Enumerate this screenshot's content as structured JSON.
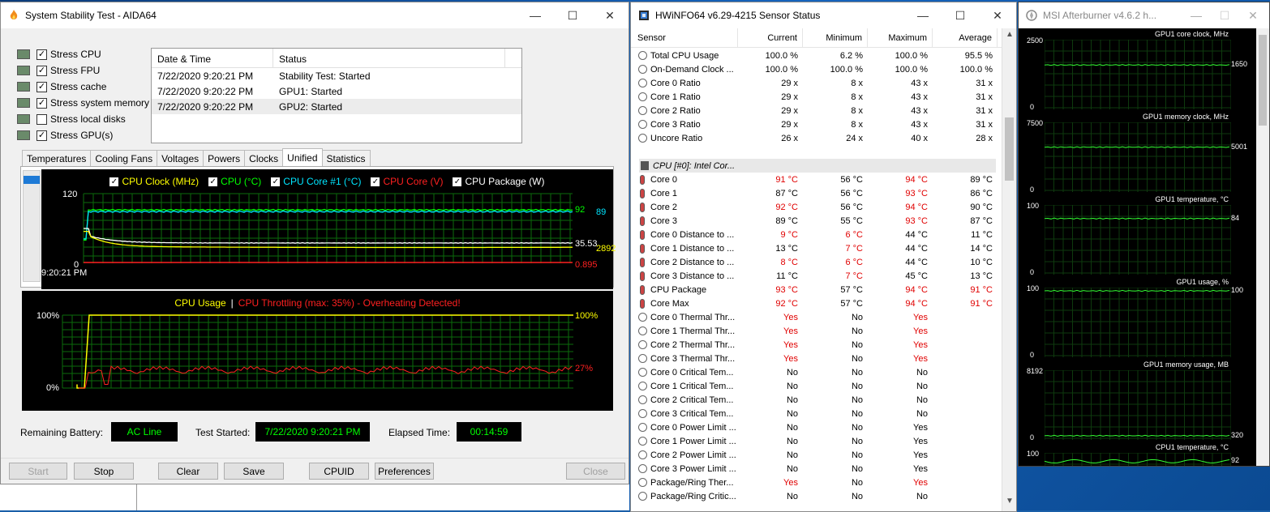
{
  "aida": {
    "title": "System Stability Test - AIDA64",
    "stress": [
      {
        "label": "Stress CPU",
        "checked": true
      },
      {
        "label": "Stress FPU",
        "checked": true
      },
      {
        "label": "Stress cache",
        "checked": true
      },
      {
        "label": "Stress system memory",
        "checked": true
      },
      {
        "label": "Stress local disks",
        "checked": false
      },
      {
        "label": "Stress GPU(s)",
        "checked": true
      }
    ],
    "status_headers": [
      "Date & Time",
      "Status"
    ],
    "status_rows": [
      [
        "7/22/2020 9:20:21 PM",
        "Stability Test: Started"
      ],
      [
        "7/22/2020 9:20:22 PM",
        "GPU1: Started"
      ],
      [
        "7/22/2020 9:20:22 PM",
        "GPU2: Started"
      ]
    ],
    "tabs": [
      "Temperatures",
      "Cooling Fans",
      "Voltages",
      "Powers",
      "Clocks",
      "Unified",
      "Statistics"
    ],
    "active_tab": "Unified",
    "graph1": {
      "legend": [
        {
          "label": "CPU Clock (MHz)",
          "color": "#ffff00"
        },
        {
          "label": "CPU (°C)",
          "color": "#00ff00"
        },
        {
          "label": "CPU Core #1 (°C)",
          "color": "#00e5ff"
        },
        {
          "label": "CPU Core (V)",
          "color": "#ff2020"
        },
        {
          "label": "CPU Package (W)",
          "color": "#ffffff"
        }
      ],
      "y_max": "120",
      "y_min": "0",
      "time": "9:20:21 PM",
      "val_cpu": "92",
      "val_core1": "89",
      "val_pkg": "35.53",
      "val_clock": "2892",
      "val_volt": "0.895"
    },
    "graph2": {
      "title_usage": "CPU Usage",
      "sep": "|",
      "title_throttle": "CPU Throttling (max: 35%) - Overheating Detected!",
      "y_max": "100%",
      "y_min": "0%",
      "val_usage": "100%",
      "val_throttle": "27%"
    },
    "info": {
      "battery_label": "Remaining Battery:",
      "battery_value": "AC Line",
      "started_label": "Test Started:",
      "started_value": "7/22/2020 9:20:21 PM",
      "elapsed_label": "Elapsed Time:",
      "elapsed_value": "00:14:59"
    },
    "buttons": {
      "start": "Start",
      "stop": "Stop",
      "clear": "Clear",
      "save": "Save",
      "cpuid": "CPUID",
      "preferences": "Preferences",
      "close": "Close"
    }
  },
  "hwinfo": {
    "title": "HWiNFO64 v6.29-4215 Sensor Status",
    "headers": [
      "Sensor",
      "Current",
      "Minimum",
      "Maximum",
      "Average"
    ],
    "rows_top": [
      {
        "name": "Total CPU Usage",
        "cur": "100.0 %",
        "min": "6.2 %",
        "max": "100.0 %",
        "avg": "95.5 %"
      },
      {
        "name": "On-Demand Clock ...",
        "cur": "100.0 %",
        "min": "100.0 %",
        "max": "100.0 %",
        "avg": "100.0 %"
      },
      {
        "name": "Core 0 Ratio",
        "cur": "29 x",
        "min": "8 x",
        "max": "43 x",
        "avg": "31 x"
      },
      {
        "name": "Core 1 Ratio",
        "cur": "29 x",
        "min": "8 x",
        "max": "43 x",
        "avg": "31 x"
      },
      {
        "name": "Core 2 Ratio",
        "cur": "29 x",
        "min": "8 x",
        "max": "43 x",
        "avg": "31 x"
      },
      {
        "name": "Core 3 Ratio",
        "cur": "29 x",
        "min": "8 x",
        "max": "43 x",
        "avg": "31 x"
      },
      {
        "name": "Uncore Ratio",
        "cur": "26 x",
        "min": "24 x",
        "max": "40 x",
        "avg": "28 x"
      }
    ],
    "group": "CPU [#0]: Intel Cor...",
    "rows_cpu": [
      {
        "name": "Core 0",
        "cur": "91 °C",
        "min": "56 °C",
        "max": "94 °C",
        "avg": "89 °C",
        "rc": 1,
        "rx": 1
      },
      {
        "name": "Core 1",
        "cur": "87 °C",
        "min": "56 °C",
        "max": "93 °C",
        "avg": "86 °C",
        "rc": 0,
        "rx": 1
      },
      {
        "name": "Core 2",
        "cur": "92 °C",
        "min": "56 °C",
        "max": "94 °C",
        "avg": "90 °C",
        "rc": 1,
        "rx": 1
      },
      {
        "name": "Core 3",
        "cur": "89 °C",
        "min": "55 °C",
        "max": "93 °C",
        "avg": "87 °C",
        "rc": 0,
        "rx": 1
      },
      {
        "name": "Core 0 Distance to ...",
        "cur": "9 °C",
        "min": "6 °C",
        "max": "44 °C",
        "avg": "11 °C",
        "rc": 1,
        "rm": 1
      },
      {
        "name": "Core 1 Distance to ...",
        "cur": "13 °C",
        "min": "7 °C",
        "max": "44 °C",
        "avg": "14 °C",
        "rm": 1
      },
      {
        "name": "Core 2 Distance to ...",
        "cur": "8 °C",
        "min": "6 °C",
        "max": "44 °C",
        "avg": "10 °C",
        "rc": 1,
        "rm": 1
      },
      {
        "name": "Core 3 Distance to ...",
        "cur": "11 °C",
        "min": "7 °C",
        "max": "45 °C",
        "avg": "13 °C",
        "rm": 1
      },
      {
        "name": "CPU Package",
        "cur": "93 °C",
        "min": "57 °C",
        "max": "94 °C",
        "avg": "91 °C",
        "rc": 1,
        "rx": 1,
        "ra": 1
      },
      {
        "name": "Core Max",
        "cur": "92 °C",
        "min": "57 °C",
        "max": "94 °C",
        "avg": "91 °C",
        "rc": 1,
        "rx": 1,
        "ra": 1
      },
      {
        "name": "Core 0 Thermal Thr...",
        "cur": "Yes",
        "min": "No",
        "max": "Yes",
        "avg": "",
        "rc": 1,
        "rx": 1
      },
      {
        "name": "Core 1 Thermal Thr...",
        "cur": "Yes",
        "min": "No",
        "max": "Yes",
        "avg": "",
        "rc": 1,
        "rx": 1
      },
      {
        "name": "Core 2 Thermal Thr...",
        "cur": "Yes",
        "min": "No",
        "max": "Yes",
        "avg": "",
        "rc": 1,
        "rx": 1
      },
      {
        "name": "Core 3 Thermal Thr...",
        "cur": "Yes",
        "min": "No",
        "max": "Yes",
        "avg": "",
        "rc": 1,
        "rx": 1
      },
      {
        "name": "Core 0 Critical Tem...",
        "cur": "No",
        "min": "No",
        "max": "No",
        "avg": ""
      },
      {
        "name": "Core 1 Critical Tem...",
        "cur": "No",
        "min": "No",
        "max": "No",
        "avg": ""
      },
      {
        "name": "Core 2 Critical Tem...",
        "cur": "No",
        "min": "No",
        "max": "No",
        "avg": ""
      },
      {
        "name": "Core 3 Critical Tem...",
        "cur": "No",
        "min": "No",
        "max": "No",
        "avg": ""
      },
      {
        "name": "Core 0 Power Limit ...",
        "cur": "No",
        "min": "No",
        "max": "Yes",
        "avg": ""
      },
      {
        "name": "Core 1 Power Limit ...",
        "cur": "No",
        "min": "No",
        "max": "Yes",
        "avg": ""
      },
      {
        "name": "Core 2 Power Limit ...",
        "cur": "No",
        "min": "No",
        "max": "Yes",
        "avg": ""
      },
      {
        "name": "Core 3 Power Limit ...",
        "cur": "No",
        "min": "No",
        "max": "Yes",
        "avg": ""
      },
      {
        "name": "Package/Ring Ther...",
        "cur": "Yes",
        "min": "No",
        "max": "Yes",
        "avg": "",
        "rc": 1,
        "rx": 1
      },
      {
        "name": "Package/Ring Critic...",
        "cur": "No",
        "min": "No",
        "max": "No",
        "avg": ""
      }
    ]
  },
  "msi": {
    "title": "MSI Afterburner v4.6.2 h...",
    "graphs": [
      {
        "label": "GPU1 core clock, MHz",
        "max": "2500",
        "min": "0",
        "value": "1650"
      },
      {
        "label": "GPU1 memory clock, MHz",
        "max": "7500",
        "min": "0",
        "value": "5001"
      },
      {
        "label": "GPU1 temperature, °C",
        "max": "100",
        "min": "0",
        "value": "84"
      },
      {
        "label": "GPU1 usage, %",
        "max": "100",
        "min": "0",
        "value": "100"
      },
      {
        "label": "GPU1 memory usage, MB",
        "max": "8192",
        "min": "0",
        "value": "320"
      },
      {
        "label": "CPU1 temperature, °C",
        "max": "100",
        "min": "",
        "value": "92"
      }
    ]
  }
}
